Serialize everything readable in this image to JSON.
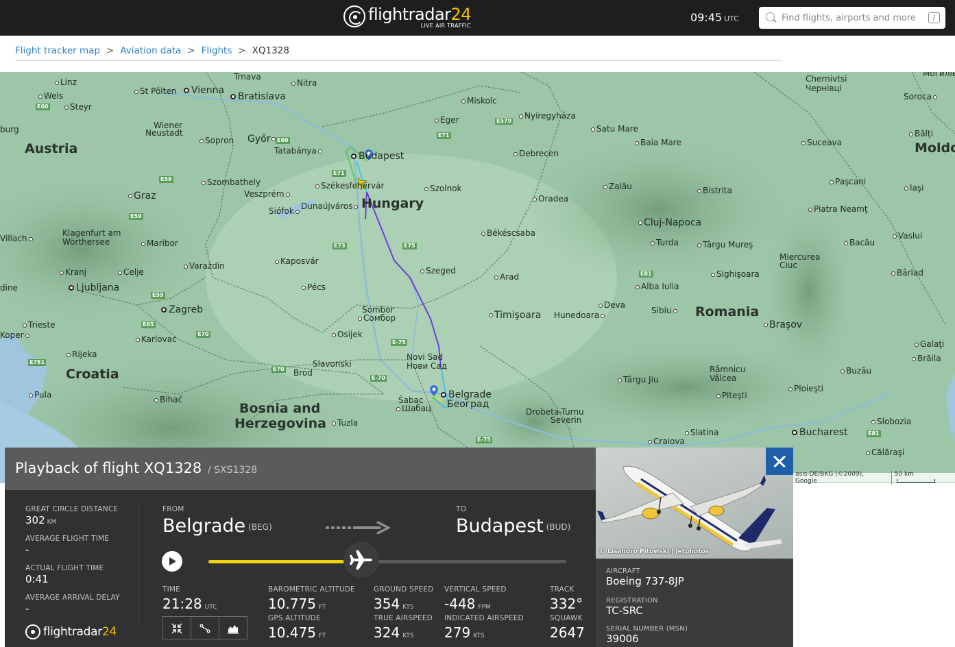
{
  "header": {
    "logo_word": "flightradar",
    "logo_number": "24",
    "logo_tagline": "LIVE AIR TRAFFIC",
    "time": "09:45",
    "time_zone": "UTC",
    "search_placeholder": "Find flights, airports and more",
    "search_shortcut": "/"
  },
  "breadcrumb": {
    "items": [
      "Flight tracker map",
      "Aviation data",
      "Flights"
    ],
    "current": "XQ1328",
    "separator": ">"
  },
  "map": {
    "countries": [
      "Austria",
      "Hungary",
      "Croatia",
      "Bosnia and",
      "Herzegovina",
      "Romania",
      "Moldo"
    ],
    "cities": [
      "Linz",
      "Wels",
      "Steyr",
      "St Pölten",
      "Vienna",
      "Trnava",
      "Bratislava",
      "Nitra",
      "Miskolc",
      "Eger",
      "Nyíregyháza",
      "Satu Mare",
      "Baia Mare",
      "Suceava",
      "Chernivtsi",
      "Чернівці",
      "Soroca",
      "Bălţi",
      "burg",
      "Wiener",
      "Neustadt",
      "Sopron",
      "Győr",
      "Tatabánya",
      "Budapest",
      "Debrecen",
      "Szombathely",
      "Veszprém",
      "Székesfehérvár",
      "Szolnok",
      "Zalău",
      "Bistrita",
      "Paşcani",
      "Iaşi",
      "Graz",
      "Siófok",
      "Dunaújváros",
      "Oradea",
      "Piatra Neamţ",
      "Cluj-Napoca",
      "Klagenfurt am",
      "Wörthersee",
      "Maribor",
      "Villach",
      "Békéscsaba",
      "Turda",
      "Târgu Mureş",
      "Bacău",
      "Vaslui",
      "Kaposvár",
      "Miercurea",
      "Ciuc",
      "Varaždin",
      "Kranj",
      "Celje",
      "Szeged",
      "Arad",
      "Sighişoara",
      "Bârlad",
      "Ljubljana",
      "Pécs",
      "Alba Iulia",
      "dine",
      "Zagreb",
      "Sombor",
      "Сомбор",
      "Deva",
      "Timişoara",
      "Hunedoara",
      "Sibiu",
      "Braşov",
      "Trieste",
      "Koper",
      "Karlovac",
      "Osijek",
      "Galaţi",
      "Rijeka",
      "Brăila",
      "Novi Sad",
      "Нови Сад",
      "Slavonski",
      "Brod",
      "Buzău",
      "Târgu Jiu",
      "Râmnicu",
      "Vâlcea",
      "Pula",
      "Bihać",
      "Šabac",
      "Шабац",
      "Belgrade",
      "Београд",
      "Ploieşti",
      "Piteşti",
      "Drobeta-Turnu",
      "Severin",
      "Tuzla",
      "Slatina",
      "Slobozia",
      "Craiova",
      "Bucharest",
      "Călăraşi",
      "Могилів-Поді"
    ],
    "roads": [
      "E60",
      "E60",
      "E59",
      "E59",
      "E71",
      "E71",
      "E73",
      "E75",
      "E59",
      "E65",
      "E70",
      "E751",
      "E70",
      "E-75",
      "E-70",
      "E-75",
      "E579",
      "E81",
      "E81"
    ],
    "attribution": "asis-DE/BKG (©2009), Google",
    "scale_label": "50 km",
    "track_colors": {
      "climb": "#59c86a",
      "cruise": "#6a3fd8",
      "descent": "#49c2e6",
      "start": "#f1dd1c"
    },
    "pin_color": "#3a6fd1"
  },
  "playback": {
    "title_prefix": "Playback of flight",
    "flight_number": "XQ1328",
    "callsign": "/ SXS1328",
    "great_circle_label": "GREAT CIRCLE DISTANCE",
    "great_circle_value": "302",
    "great_circle_unit": "KM",
    "avg_flight_time_label": "AVERAGE FLIGHT TIME",
    "avg_flight_time_value": "-",
    "actual_flight_time_label": "ACTUAL FLIGHT TIME",
    "actual_flight_time_value": "0:41",
    "avg_arrival_delay_label": "AVERAGE ARRIVAL DELAY",
    "avg_arrival_delay_value": "-",
    "from_label": "FROM",
    "from_city": "Belgrade",
    "from_code": "(BEG)",
    "to_label": "TO",
    "to_city": "Budapest",
    "to_code": "(BUD)",
    "progress_fraction": 0.428,
    "time_label": "TIME",
    "time_value": "21:28",
    "time_unit": "UTC",
    "baro_alt_label": "BAROMETRIC ALTITUDE",
    "baro_alt_value": "10.775",
    "baro_alt_unit": "FT",
    "gps_alt_label": "GPS ALTITUDE",
    "gps_alt_value": "10.475",
    "gps_alt_unit": "FT",
    "ground_speed_label": "GROUND SPEED",
    "ground_speed_value": "354",
    "ground_speed_unit": "KTS",
    "true_airspeed_label": "TRUE AIRSPEED",
    "true_airspeed_value": "324",
    "true_airspeed_unit": "KTS",
    "vertical_speed_label": "VERTICAL SPEED",
    "vertical_speed_value": "-448",
    "vertical_speed_unit": "FPM",
    "indicated_airspeed_label": "INDICATED AIRSPEED",
    "indicated_airspeed_value": "279",
    "indicated_airspeed_unit": "KTS",
    "track_label": "TRACK",
    "track_value": "332°",
    "squawk_label": "SQUAWK",
    "squawk_value": "2647",
    "footer_word": "flightradar",
    "footer_number": "24"
  },
  "aircraft": {
    "photo_credit": "© Lisandro Pitowski | Jetphotos",
    "aircraft_label": "AIRCRAFT",
    "aircraft_value": "Boeing 737-8JP",
    "registration_label": "REGISTRATION",
    "registration_value": "TC-SRC",
    "serial_label": "SERIAL NUMBER (MSN)",
    "serial_value": "39006"
  },
  "colors": {
    "header_bg": "#1d1e1f",
    "link": "#2f7dc6",
    "panel_bg": "#303133",
    "panel_head": "#5a5b5c",
    "progress": "#f2d30b",
    "close_button": "#1e5fa8",
    "brand_accent": "#fcc100"
  }
}
